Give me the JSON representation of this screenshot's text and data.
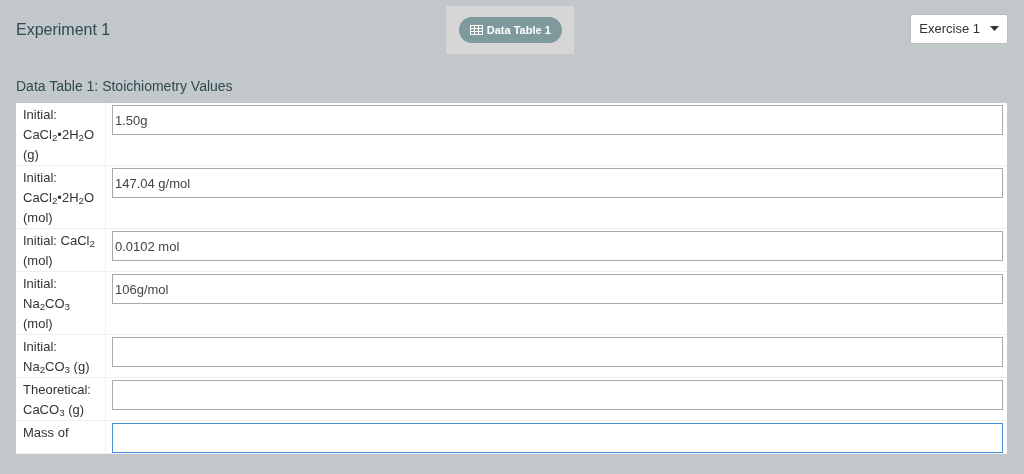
{
  "header": {
    "title": "Experiment 1",
    "tab": {
      "label": "Data Table 1",
      "selected": true
    },
    "dropdown": {
      "value": "Exercise 1"
    }
  },
  "table": {
    "title": "Data Table 1: Stoichiometry Values",
    "rows": [
      {
        "label": "Initial: CaCl$_{2}$•2H$_{2}$O (g)",
        "value": "1.50g",
        "focused": false
      },
      {
        "label": "Initial: CaCl$_{2}$•2H$_{2}$O (mol)",
        "value": "147.04 g/mol",
        "focused": false
      },
      {
        "label": "Initial: CaCl$_{2}$ (mol)",
        "value": "0.0102 mol",
        "focused": false
      },
      {
        "label": "Initial: Na$_{2}$CO$_{3}$ (mol)",
        "value": "106g/mol",
        "focused": false
      },
      {
        "label": "Initial: Na$_{2}$CO$_{3}$ (g)",
        "value": "",
        "focused": false
      },
      {
        "label": "Theoretical: CaCO$_{3}$ (g)",
        "value": "",
        "focused": false
      },
      {
        "label": "Mass of",
        "value": "",
        "focused": true
      }
    ]
  }
}
